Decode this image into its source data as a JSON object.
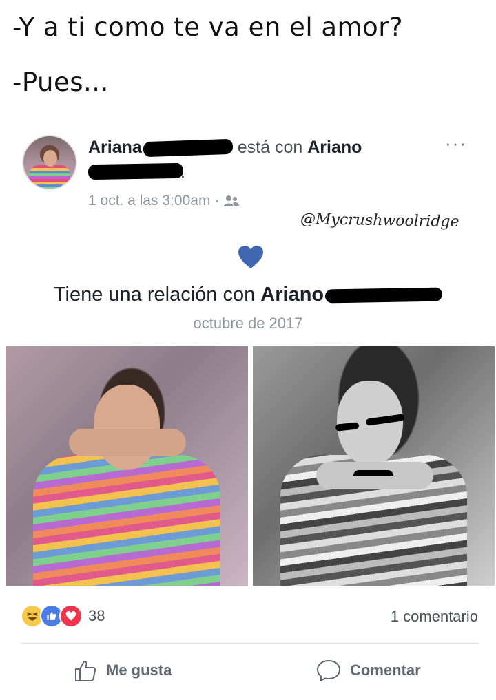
{
  "caption": {
    "line1": "-Y a ti como te va en el amor?",
    "line2": "-Pues..."
  },
  "post": {
    "author_first": "Ariana",
    "with_text": "está con",
    "tagged_first": "Ariano",
    "time": "1 oct. a las 3:00am",
    "separator": "·",
    "audience_icon": "friends-icon",
    "more_icon": "more-options-icon",
    "watermark": "@Mycrushwoolridge",
    "relationship_prefix": "Tiene una relación con",
    "relationship_partner": "Ariano",
    "relationship_date": "octubre de 2017",
    "heart_color": "#4267b2"
  },
  "reactions": {
    "icons": [
      "haha-icon",
      "like-icon",
      "love-icon"
    ],
    "count": "38",
    "comments": "1 comentario"
  },
  "actions": {
    "like_label": "Me gusta",
    "comment_label": "Comentar"
  }
}
